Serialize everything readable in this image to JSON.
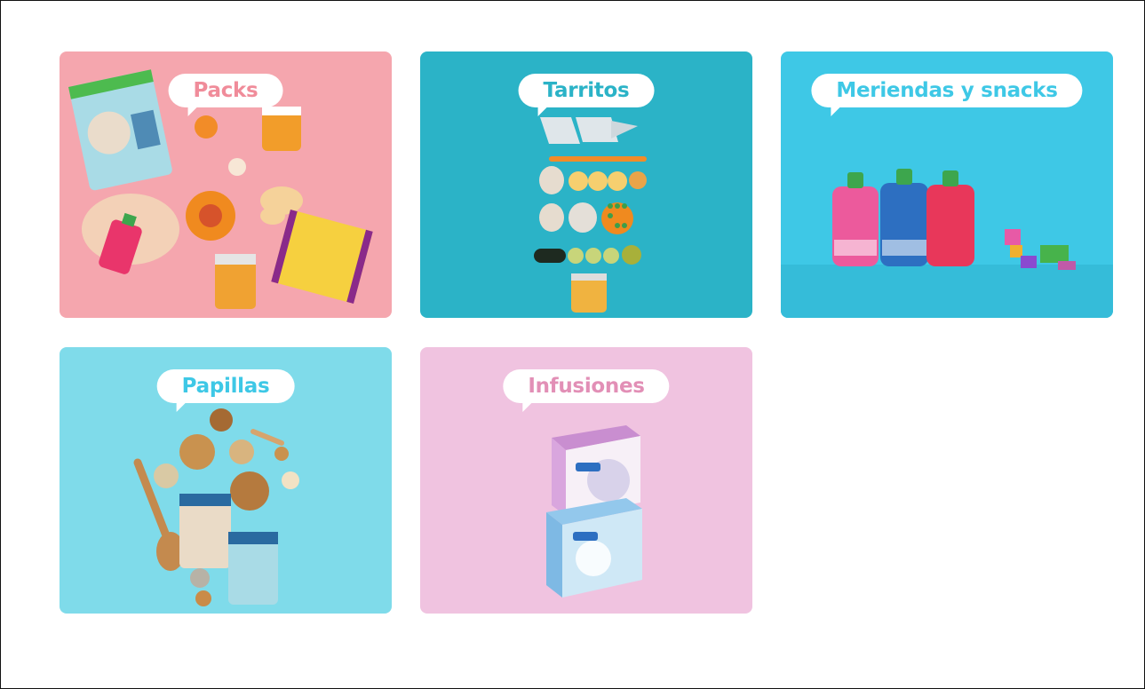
{
  "categories": [
    {
      "label": "Packs",
      "bg": "#f5a6ae",
      "text_color": "#f08c9a"
    },
    {
      "label": "Tarritos",
      "bg": "#2bb3c7",
      "text_color": "#2bb3c7"
    },
    {
      "label": "Meriendas y snacks",
      "bg": "#3ec8e6",
      "text_color": "#3ec8e6"
    },
    {
      "label": "Papillas",
      "bg": "#7fdbea",
      "text_color": "#3ec8e6"
    },
    {
      "label": "Infusiones",
      "bg": "#f0c3e0",
      "text_color": "#e28fb6"
    }
  ]
}
